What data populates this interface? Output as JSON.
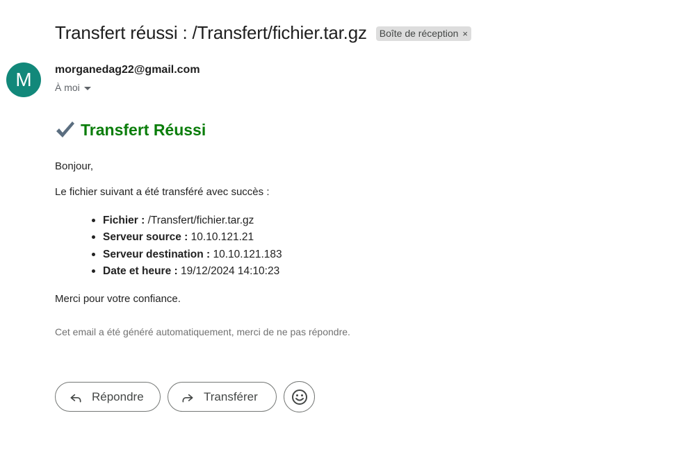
{
  "email": {
    "subject": "Transfert réussi : /Transfert/fichier.tar.gz",
    "label_chip": "Boîte de réception",
    "label_chip_close": "×",
    "sender_initial": "M",
    "sender": "morganedag22@gmail.com",
    "recipient": "À moi",
    "avatar_color": "#12887a"
  },
  "body": {
    "headline": "Transfert Réussi",
    "headline_color": "#0a7d0a",
    "greeting": "Bonjour,",
    "intro": "Le fichier suivant a été transféré avec succès :",
    "details": [
      {
        "label": "Fichier :",
        "value": "/Transfert/fichier.tar.gz"
      },
      {
        "label": "Serveur source :",
        "value": "10.10.121.21"
      },
      {
        "label": "Serveur destination :",
        "value": "10.10.121.183"
      },
      {
        "label": "Date et heure :",
        "value": "19/12/2024 14:10:23"
      }
    ],
    "thanks": "Merci pour votre confiance.",
    "auto_note": "Cet email a été généré automatiquement, merci de ne pas répondre."
  },
  "actions": {
    "reply_label": "Répondre",
    "forward_label": "Transférer",
    "reply_icon": "reply-arrow-icon",
    "forward_icon": "forward-arrow-icon",
    "emoji_icon": "smiley-icon"
  }
}
